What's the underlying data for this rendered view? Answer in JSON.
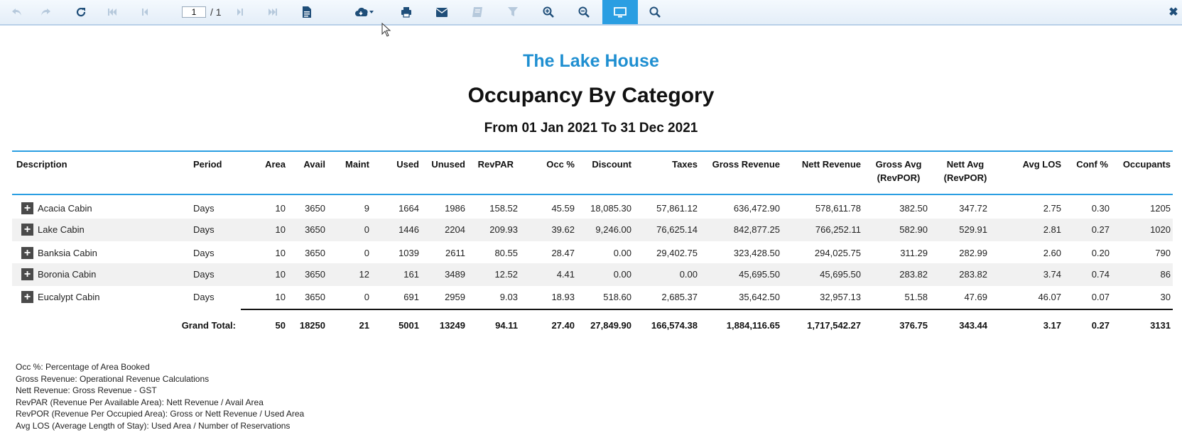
{
  "toolbar": {
    "buttons": [
      {
        "name": "undo-icon"
      },
      {
        "name": "redo-icon"
      },
      {
        "name": "refresh-icon"
      },
      {
        "name": "first-page-icon"
      },
      {
        "name": "prev-page-icon"
      },
      {
        "name": "next-page-icon"
      },
      {
        "name": "last-page-icon"
      },
      {
        "name": "document-icon"
      },
      {
        "name": "export-cloud-icon"
      },
      {
        "name": "print-icon"
      },
      {
        "name": "email-icon"
      },
      {
        "name": "bookmark-icon"
      },
      {
        "name": "filter-icon"
      },
      {
        "name": "zoom-in-icon"
      },
      {
        "name": "zoom-out-icon"
      },
      {
        "name": "view-mode-icon"
      },
      {
        "name": "search-icon"
      }
    ],
    "page_value": "1",
    "page_total": "/ 1",
    "close_label": "✖"
  },
  "report": {
    "company": "The Lake House",
    "title": "Occupancy By Category",
    "date_range": "From 01 Jan 2021 To 31 Dec 2021"
  },
  "table": {
    "headers": {
      "description": "Description",
      "period": "Period",
      "area": "Area",
      "avail": "Avail",
      "maint": "Maint",
      "used": "Used",
      "unused": "Unused",
      "revpar": "RevPAR",
      "occ": "Occ %",
      "discount": "Discount",
      "taxes": "Taxes",
      "gross_revenue": "Gross Revenue",
      "nett_revenue": "Nett Revenue",
      "gross_avg_1": "Gross Avg",
      "gross_avg_2": "(RevPOR)",
      "nett_avg_1": "Nett Avg",
      "nett_avg_2": "(RevPOR)",
      "avg_los": "Avg LOS",
      "conf": "Conf %",
      "occupants": "Occupants"
    },
    "rows": [
      {
        "description": "Acacia Cabin",
        "period": "Days",
        "area": "10",
        "avail": "3650",
        "maint": "9",
        "used": "1664",
        "unused": "1986",
        "revpar": "158.52",
        "occ": "45.59",
        "discount": "18,085.30",
        "taxes": "57,861.12",
        "gross_revenue": "636,472.90",
        "nett_revenue": "578,611.78",
        "gross_avg": "382.50",
        "nett_avg": "347.72",
        "avg_los": "2.75",
        "conf": "0.30",
        "occupants": "1205"
      },
      {
        "description": "Lake Cabin",
        "period": "Days",
        "area": "10",
        "avail": "3650",
        "maint": "0",
        "used": "1446",
        "unused": "2204",
        "revpar": "209.93",
        "occ": "39.62",
        "discount": "9,246.00",
        "taxes": "76,625.14",
        "gross_revenue": "842,877.25",
        "nett_revenue": "766,252.11",
        "gross_avg": "582.90",
        "nett_avg": "529.91",
        "avg_los": "2.81",
        "conf": "0.27",
        "occupants": "1020"
      },
      {
        "description": "Banksia Cabin",
        "period": "Days",
        "area": "10",
        "avail": "3650",
        "maint": "0",
        "used": "1039",
        "unused": "2611",
        "revpar": "80.55",
        "occ": "28.47",
        "discount": "0.00",
        "taxes": "29,402.75",
        "gross_revenue": "323,428.50",
        "nett_revenue": "294,025.75",
        "gross_avg": "311.29",
        "nett_avg": "282.99",
        "avg_los": "2.60",
        "conf": "0.20",
        "occupants": "790"
      },
      {
        "description": "Boronia Cabin",
        "period": "Days",
        "area": "10",
        "avail": "3650",
        "maint": "12",
        "used": "161",
        "unused": "3489",
        "revpar": "12.52",
        "occ": "4.41",
        "discount": "0.00",
        "taxes": "0.00",
        "gross_revenue": "45,695.50",
        "nett_revenue": "45,695.50",
        "gross_avg": "283.82",
        "nett_avg": "283.82",
        "avg_los": "3.74",
        "conf": "0.74",
        "occupants": "86"
      },
      {
        "description": "Eucalypt Cabin",
        "period": "Days",
        "area": "10",
        "avail": "3650",
        "maint": "0",
        "used": "691",
        "unused": "2959",
        "revpar": "9.03",
        "occ": "18.93",
        "discount": "518.60",
        "taxes": "2,685.37",
        "gross_revenue": "35,642.50",
        "nett_revenue": "32,957.13",
        "gross_avg": "51.58",
        "nett_avg": "47.69",
        "avg_los": "46.07",
        "conf": "0.07",
        "occupants": "30"
      }
    ],
    "total": {
      "label": "Grand Total:",
      "area": "50",
      "avail": "18250",
      "maint": "21",
      "used": "5001",
      "unused": "13249",
      "revpar": "94.11",
      "occ": "27.40",
      "discount": "27,849.90",
      "taxes": "166,574.38",
      "gross_revenue": "1,884,116.65",
      "nett_revenue": "1,717,542.27",
      "gross_avg": "376.75",
      "nett_avg": "343.44",
      "avg_los": "3.17",
      "conf": "0.27",
      "occupants": "3131"
    }
  },
  "notes": [
    "Occ %: Percentage of Area Booked",
    "Gross Revenue: Operational Revenue Calculations",
    "Nett Revenue: Gross Revenue - GST",
    "RevPAR (Revenue Per Available Area): Nett Revenue / Avail Area",
    "RevPOR (Revenue Per Occupied Area): Gross or Nett Revenue / Used Area",
    "Avg LOS (Average Length of Stay): Used Area / Number of Reservations"
  ],
  "colors": {
    "accent": "#2a9ee2",
    "company": "#1f8fd1",
    "toolbar_icon": "#1f4e79",
    "disabled_icon": "#b6c9dc"
  }
}
